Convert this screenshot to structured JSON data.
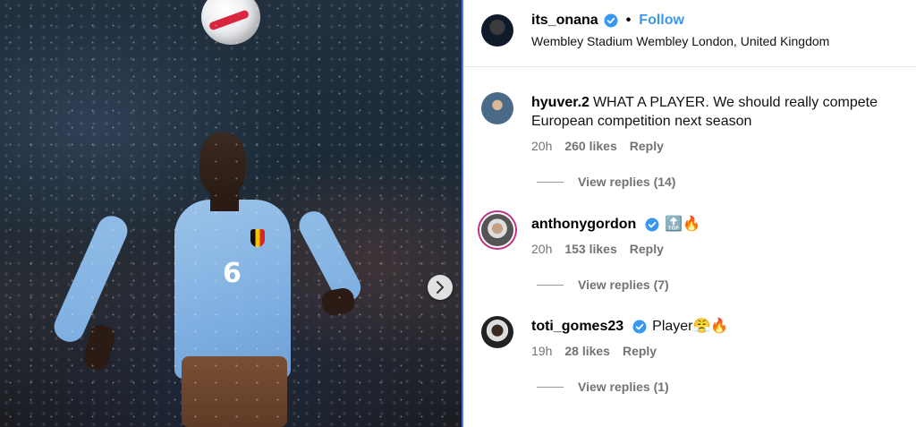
{
  "post_owner": {
    "username": "its_onana",
    "verified": true,
    "follow_label": "Follow",
    "separator": "•",
    "location": "Wembley Stadium Wembley London, United Kingdom"
  },
  "media": {
    "shirt_number": "6",
    "next_icon": "chevron-right-icon"
  },
  "comments": [
    {
      "username": "hyuver.2",
      "verified": false,
      "text": "WHAT A PLAYER. We should really compete European competition next season",
      "time": "20h",
      "likes": "260 likes",
      "reply_label": "Reply",
      "view_replies": "View replies (14)"
    },
    {
      "username": "anthonygordon",
      "verified": true,
      "text": "🔝🔥",
      "time": "20h",
      "likes": "153 likes",
      "reply_label": "Reply",
      "view_replies": "View replies (7)"
    },
    {
      "username": "toti_gomes23",
      "verified": true,
      "text": "Player😤🔥",
      "time": "19h",
      "likes": "28 likes",
      "reply_label": "Reply",
      "view_replies": "View replies (1)"
    }
  ],
  "colors": {
    "accent": "#3897f0",
    "verified": "#3897f0",
    "muted": "#737373"
  }
}
